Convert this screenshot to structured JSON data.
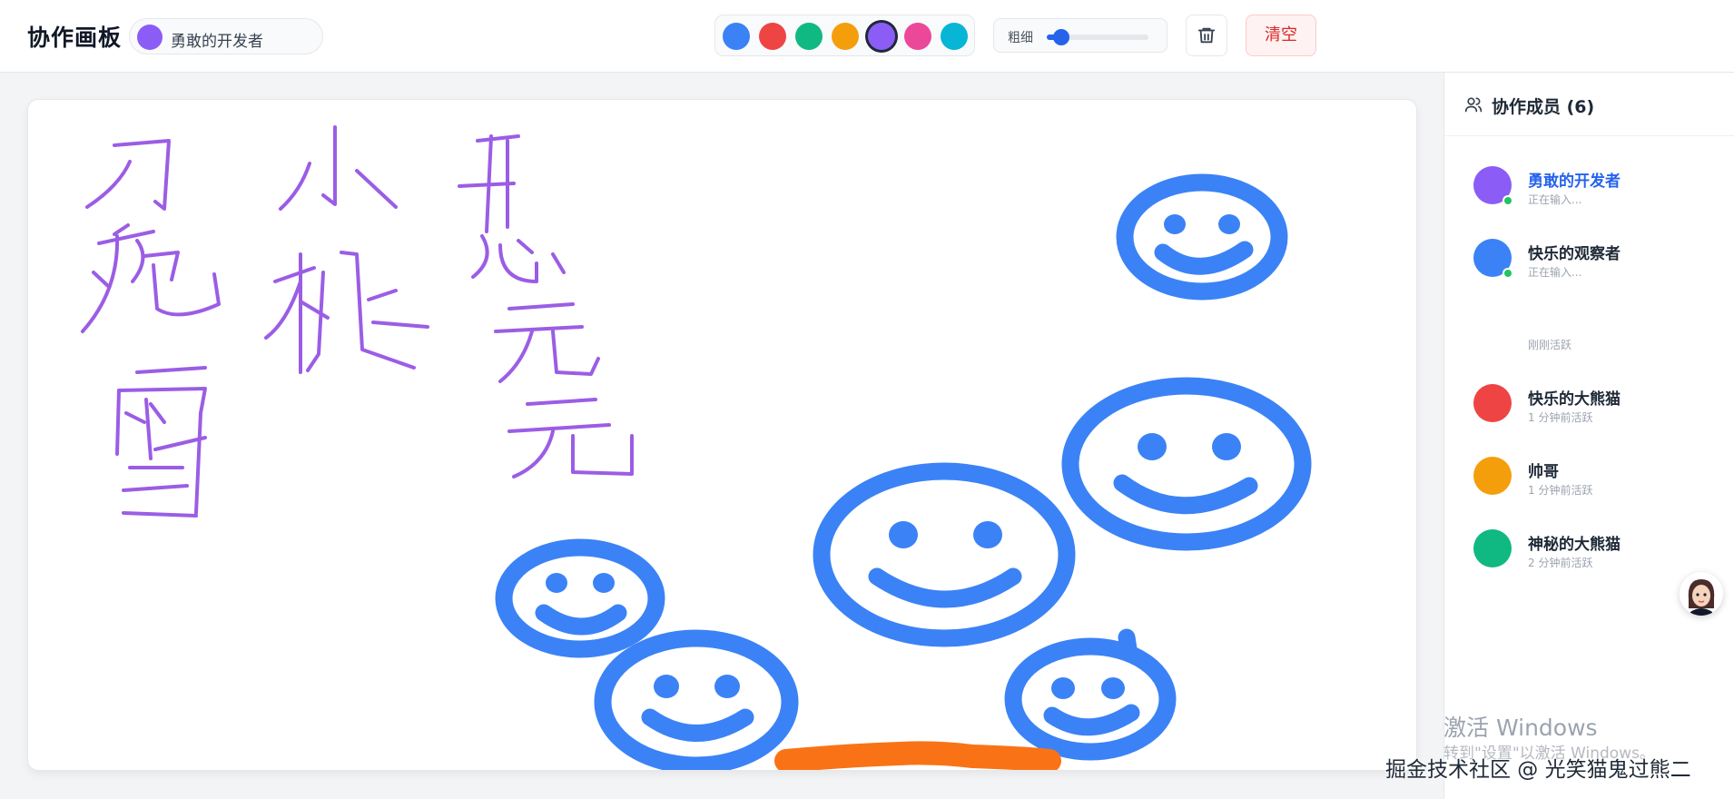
{
  "app": {
    "title": "协作画板",
    "current_user": {
      "name": "勇敢的开发者",
      "color": "#8b5cf6"
    }
  },
  "toolbar": {
    "colors": [
      "#3b82f6",
      "#ef4444",
      "#10b981",
      "#f59e0b",
      "#8b5cf6",
      "#ec4899",
      "#06b6d4"
    ],
    "selected_color": "#8b5cf6",
    "brush_label": "粗细",
    "brush_level": 0.14,
    "trash_icon": "trash-icon",
    "clear_label": "清空"
  },
  "sidebar": {
    "title": "协作成员 (6)",
    "icon": "users-icon",
    "members": [
      {
        "name": "勇敢的开发者",
        "status": "正在输入...",
        "color": "#8b5cf6",
        "online": true,
        "is_me": true
      },
      {
        "name": "快乐的观察者",
        "status": "正在输入...",
        "color": "#3b82f6",
        "online": true,
        "is_me": false
      },
      {
        "name": "",
        "status": "刚刚活跃",
        "color": "",
        "online": false,
        "is_me": false
      },
      {
        "name": "快乐的大熊猫",
        "status": "1 分钟前活跃",
        "color": "#ef4444",
        "online": false,
        "is_me": false
      },
      {
        "name": "帅哥",
        "status": "1 分钟前活跃",
        "color": "#f59e0b",
        "online": false,
        "is_me": false
      },
      {
        "name": "神秘的大熊猫",
        "status": "2 分钟前活跃",
        "color": "#10b981",
        "online": false,
        "is_me": false
      }
    ]
  },
  "canvas": {
    "ink_colors": {
      "purple": "#9b5de5",
      "blue": "#3b82f6",
      "orange": "#f97316"
    }
  },
  "overlay": {
    "activation_title": "激活 Windows",
    "activation_sub": "转到\"设置\"以激活 Windows。",
    "watermark": "掘金技术社区 @ 光笑猫鬼过熊二"
  }
}
